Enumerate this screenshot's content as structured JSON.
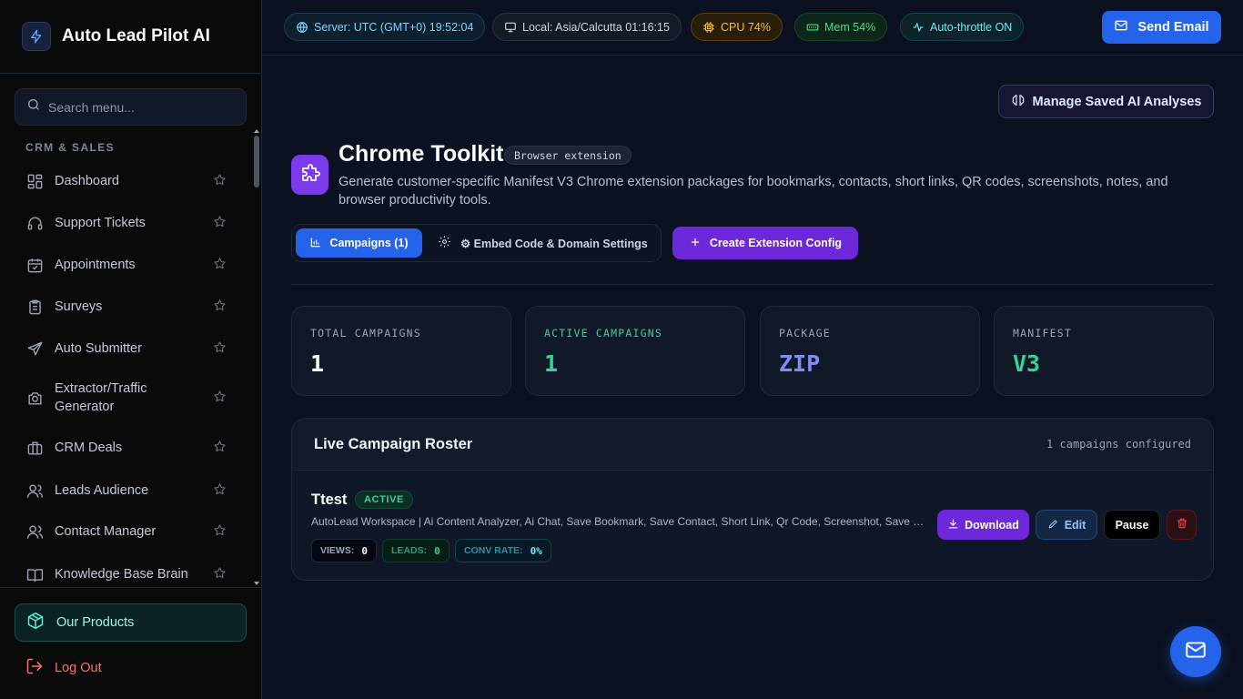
{
  "app": {
    "title": "Auto Lead Pilot AI"
  },
  "sidebar": {
    "search_placeholder": "Search menu...",
    "section_label": "CRM & SALES",
    "items": [
      {
        "label": "Dashboard",
        "icon": "dashboard-icon"
      },
      {
        "label": "Support Tickets",
        "icon": "headset-icon"
      },
      {
        "label": "Appointments",
        "icon": "calendar-check-icon"
      },
      {
        "label": "Surveys",
        "icon": "clipboard-list-icon"
      },
      {
        "label": "Auto Submitter",
        "icon": "send-icon"
      },
      {
        "label": "Extractor/Traffic Generator",
        "icon": "camera-icon"
      },
      {
        "label": "CRM Deals",
        "icon": "briefcase-icon"
      },
      {
        "label": "Leads Audience",
        "icon": "users-icon"
      },
      {
        "label": "Contact Manager",
        "icon": "users-icon"
      },
      {
        "label": "Knowledge Base Brain",
        "icon": "book-open-icon"
      }
    ],
    "products_label": "Our Products",
    "logout_label": "Log Out"
  },
  "topbar": {
    "server_time": "Server: UTC (GMT+0) 19:52:04",
    "local_time": "Local: Asia/Calcutta 01:16:15",
    "cpu": "CPU 74%",
    "mem": "Mem 54%",
    "throttle": "Auto-throttle ON",
    "send_email_label": "Send Email"
  },
  "main": {
    "manage_label": "Manage Saved AI Analyses",
    "title": "Chrome Toolkit",
    "title_badge": "Browser extension",
    "description": "Generate customer-specific Manifest V3 Chrome extension packages for bookmarks, contacts, short links, QR codes, screenshots, notes, and browser productivity tools.",
    "tabs": {
      "campaigns": "Campaigns (1)",
      "settings": "⚙ Embed Code & Domain Settings"
    },
    "create_label": "Create Extension Config",
    "stats": [
      {
        "label": "TOTAL CAMPAIGNS",
        "value": "1",
        "color": "#f8fafc",
        "label_color": "#9aa4b5"
      },
      {
        "label": "ACTIVE CAMPAIGNS",
        "value": "1",
        "color": "#34d399",
        "label_color": "#34d399"
      },
      {
        "label": "PACKAGE",
        "value": "ZIP",
        "color": "#818cf8",
        "label_color": "#9aa4b5"
      },
      {
        "label": "MANIFEST",
        "value": "V3",
        "color": "#34d399",
        "label_color": "#9aa4b5"
      }
    ],
    "roster": {
      "title": "Live Campaign Roster",
      "count": "1 campaigns configured",
      "campaign": {
        "name": "Ttest",
        "status": "ACTIVE",
        "description": "AutoLead Workspace | Ai Content Analyzer, Ai Chat, Save Bookmark, Save Contact, Short Link, Qr Code, Screenshot, Save Note, Page Notes",
        "views_label": "VIEWS:",
        "views": "0",
        "leads_label": "LEADS:",
        "leads": "0",
        "conv_label": "CONV RATE:",
        "conv": "0%",
        "download_label": "Download",
        "edit_label": "Edit",
        "pause_label": "Pause"
      }
    }
  },
  "colors": {
    "accent_blue": "#2563eb",
    "accent_purple": "#6d28d9",
    "success_green": "#34d399",
    "danger_red": "#f87171"
  }
}
